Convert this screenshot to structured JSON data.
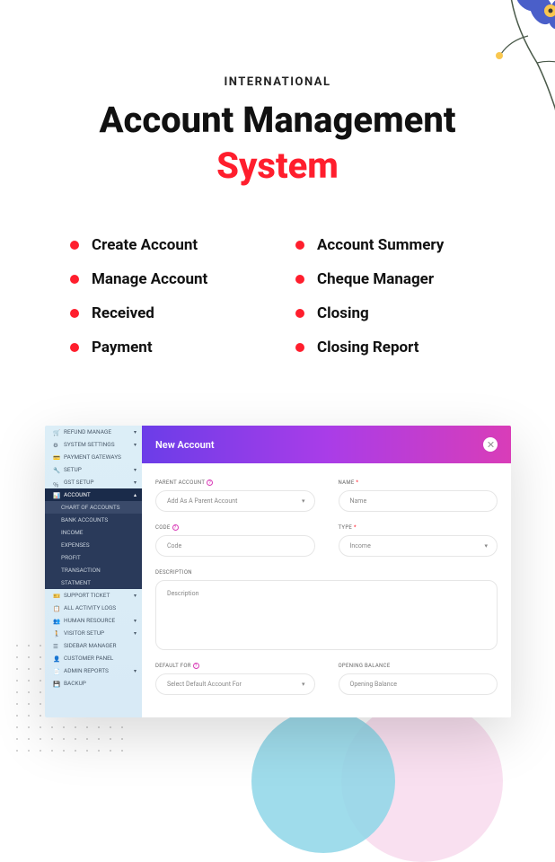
{
  "hero": {
    "eyebrow": "INTERNATIONAL",
    "line1": "Account Management",
    "line2": "System"
  },
  "features": {
    "col1": [
      "Create Account",
      "Manage Account",
      "Received",
      "Payment"
    ],
    "col2": [
      "Account Summery",
      "Cheque Manager",
      "Closing",
      "Closing Report"
    ]
  },
  "sidebar": {
    "top": [
      {
        "label": "REFUND MANAGE"
      },
      {
        "label": "SYSTEM SETTINGS"
      },
      {
        "label": "PAYMENT GATEWAYS"
      },
      {
        "label": "SETUP"
      },
      {
        "label": "GST SETUP"
      }
    ],
    "account_label": "ACCOUNT",
    "subs": [
      {
        "label": "CHART OF ACCOUNTS",
        "active": true
      },
      {
        "label": "BANK ACCOUNTS"
      },
      {
        "label": "INCOME"
      },
      {
        "label": "EXPENSES"
      },
      {
        "label": "PROFIT"
      },
      {
        "label": "TRANSACTION"
      },
      {
        "label": "STATMENT"
      }
    ],
    "bottom": [
      {
        "label": "SUPPORT TICKET"
      },
      {
        "label": "ALL ACTIVITY LOGS"
      },
      {
        "label": "HUMAN RESOURCE"
      },
      {
        "label": "VISITOR SETUP"
      },
      {
        "label": "SIDEBAR MANAGER"
      },
      {
        "label": "CUSTOMER PANEL"
      },
      {
        "label": "ADMIN REPORTS"
      },
      {
        "label": "BACKUP"
      }
    ]
  },
  "modal": {
    "title": "New Account",
    "fields": {
      "parent_account": {
        "label": "PARENT ACCOUNT",
        "placeholder": "Add As A Parent Account",
        "info": true
      },
      "name": {
        "label": "NAME",
        "placeholder": "Name",
        "required": true
      },
      "code": {
        "label": "CODE",
        "placeholder": "Code",
        "info": true
      },
      "type": {
        "label": "TYPE",
        "placeholder": "Income",
        "required": true
      },
      "description": {
        "label": "DESCRIPTION",
        "placeholder": "Description"
      },
      "default_for": {
        "label": "DEFAULT FOR",
        "placeholder": "Select Default Account For",
        "info": true
      },
      "opening_balance": {
        "label": "OPENING BALANCE",
        "placeholder": "Opening Balance"
      }
    }
  }
}
